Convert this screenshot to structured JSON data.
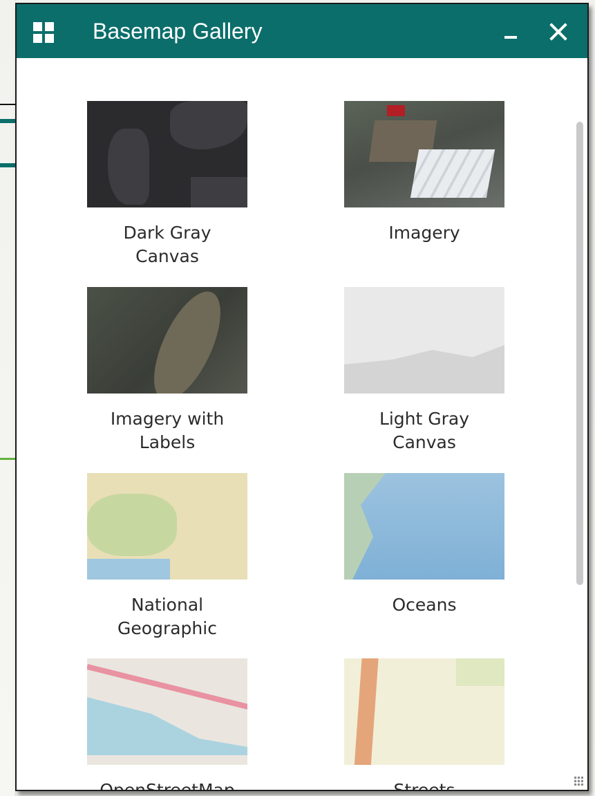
{
  "window": {
    "title": "Basemap Gallery",
    "minimize_icon": "minimize-icon",
    "close_icon": "close-icon"
  },
  "colors": {
    "titlebar": "#0b6e6b",
    "panel_bg": "#ffffff",
    "label_text": "#2b2b2b"
  },
  "basemaps": [
    {
      "label": "Dark Gray\nCanvas"
    },
    {
      "label": "Imagery"
    },
    {
      "label": "Imagery with\nLabels"
    },
    {
      "label": "Light Gray\nCanvas"
    },
    {
      "label": "National\nGeographic"
    },
    {
      "label": "Oceans"
    },
    {
      "label": "OpenStreetMap"
    },
    {
      "label": "Streets"
    }
  ]
}
